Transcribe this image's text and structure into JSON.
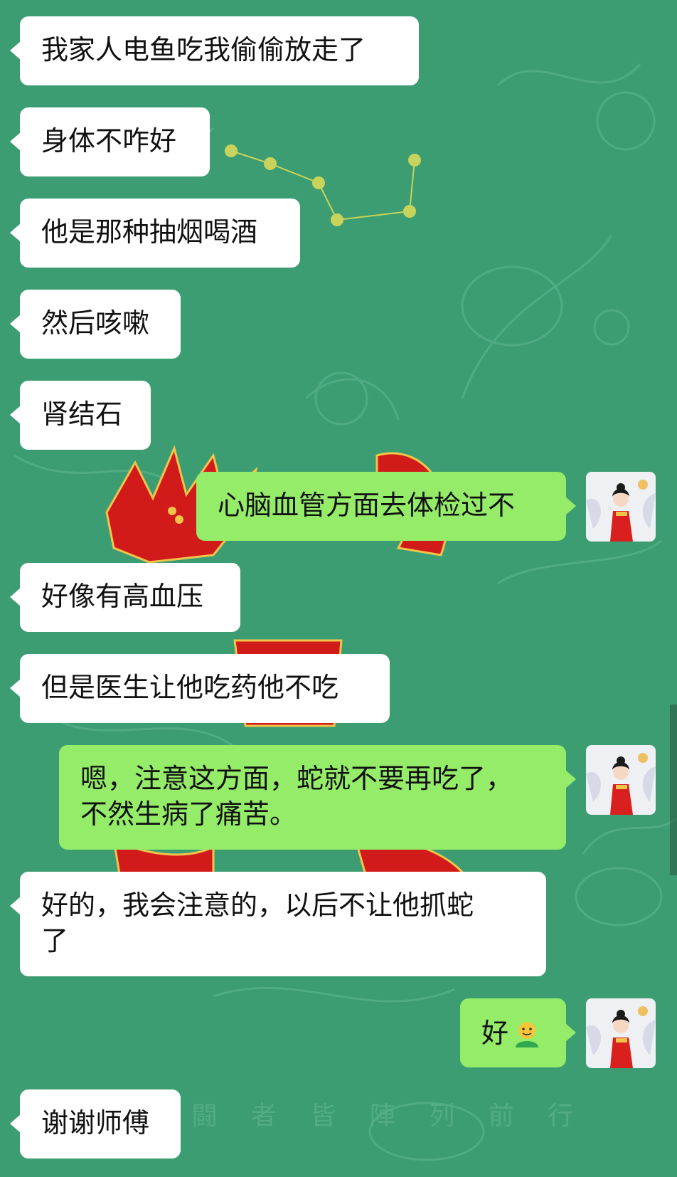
{
  "messages": [
    {
      "side": "left",
      "text": "我家人电鱼吃我偷偷放走了"
    },
    {
      "side": "left",
      "text": "身体不咋好"
    },
    {
      "side": "left",
      "text": "他是那种抽烟喝酒"
    },
    {
      "side": "left",
      "text": "然后咳嗽"
    },
    {
      "side": "left",
      "text": "肾结石"
    },
    {
      "side": "right",
      "text": "心脑血管方面去体检过不"
    },
    {
      "side": "left",
      "text": "好像有高血压"
    },
    {
      "side": "left",
      "text": "但是医生让他吃药他不吃"
    },
    {
      "side": "right",
      "lines": [
        "嗯，注意这方面，蛇就不要再吃了，",
        "不然生病了痛苦。"
      ]
    },
    {
      "side": "left",
      "lines": [
        "好的，我会注意的，以后不让他抓蛇",
        "了"
      ]
    },
    {
      "side": "right",
      "text": "好",
      "emoji": "smiling-person-emoji"
    },
    {
      "side": "left",
      "text": "谢谢师傅"
    }
  ],
  "colors": {
    "background": "#3d9d72",
    "incoming_bubble": "#ffffff",
    "outgoing_bubble": "#95ec69",
    "wallpaper_red": "#d11b1b"
  }
}
